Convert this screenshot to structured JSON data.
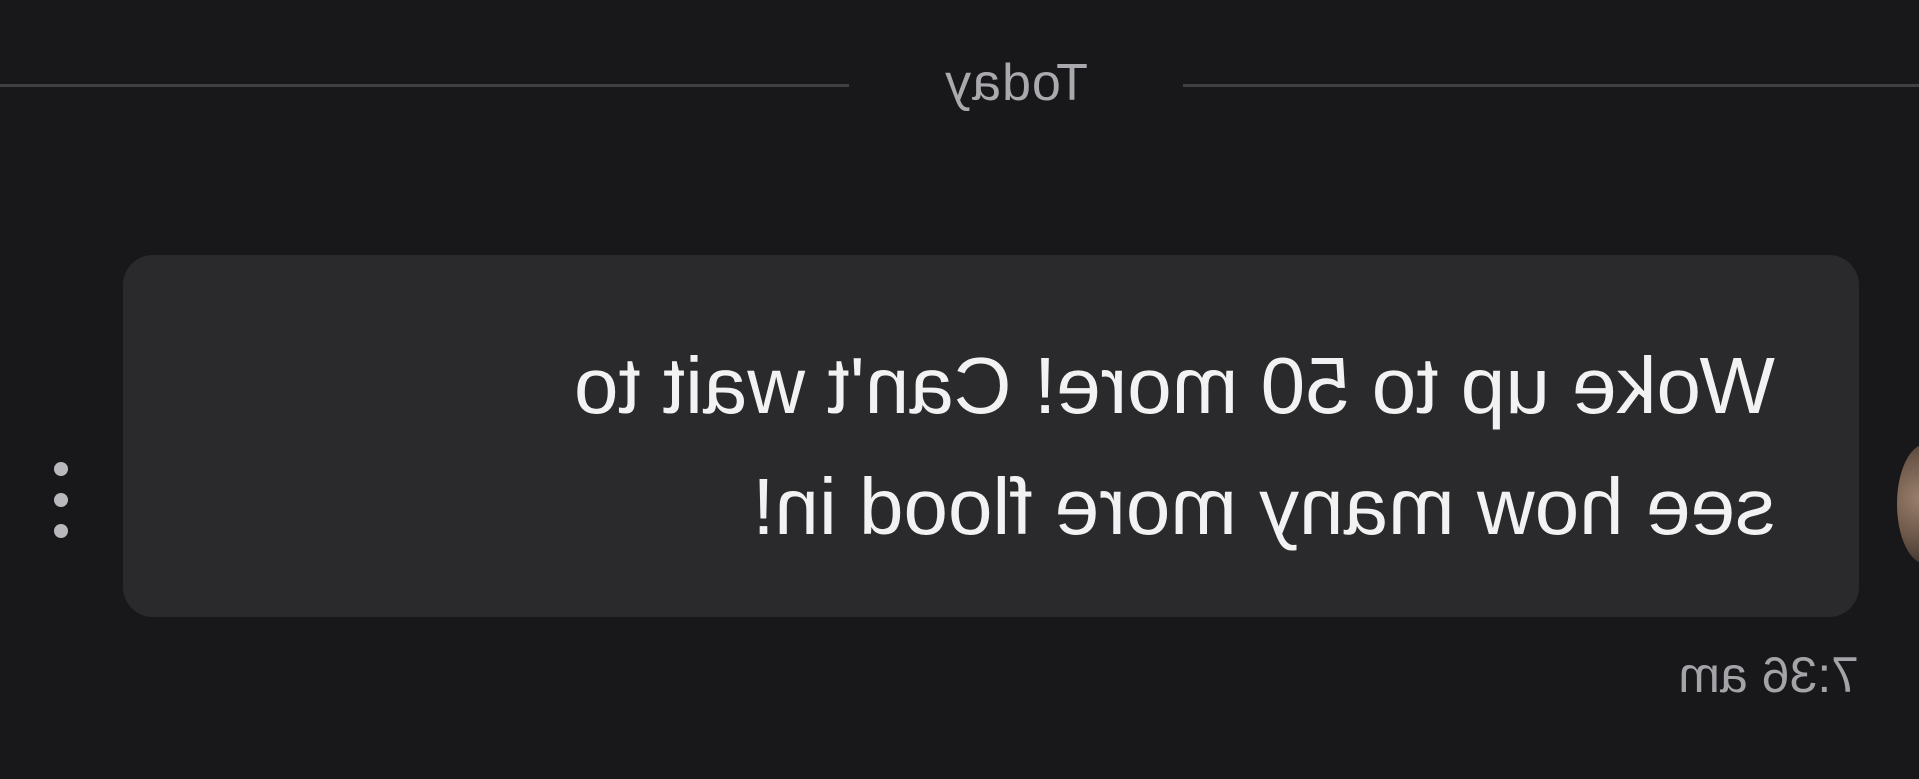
{
  "divider": {
    "label": "Today"
  },
  "message": {
    "text": "Woke up to 50 more! Can't wait to\nsee how many more flood in!",
    "time": "7:36 am"
  },
  "icons": {
    "more_options": "vertical-ellipsis-icon",
    "avatar": "user-avatar"
  },
  "colors": {
    "background": "#18181a",
    "bubble": "#2a2a2d",
    "text": "#f2f2f2",
    "muted": "#a9a9ae"
  }
}
